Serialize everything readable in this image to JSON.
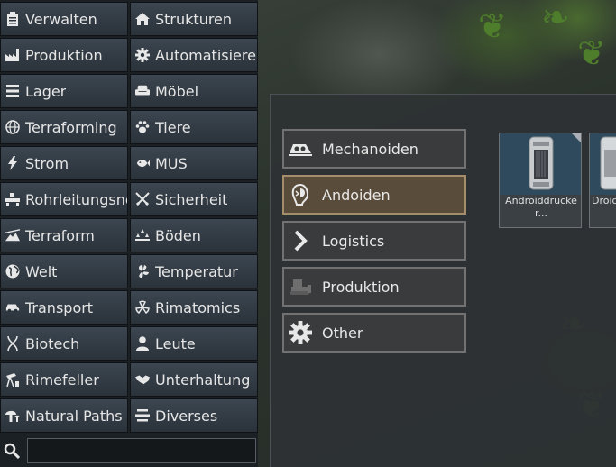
{
  "architect": {
    "categories": [
      {
        "label": "Verwalten",
        "icon": "clipboard-icon"
      },
      {
        "label": "Strukturen",
        "icon": "house-icon"
      },
      {
        "label": "Produktion",
        "icon": "factory-icon"
      },
      {
        "label": "Automatisieren",
        "icon": "gear-icon"
      },
      {
        "label": "Lager",
        "icon": "shelf-icon"
      },
      {
        "label": "Möbel",
        "icon": "armchair-icon"
      },
      {
        "label": "Terraforming",
        "icon": "globe-icon"
      },
      {
        "label": "Tiere",
        "icon": "paw-icon"
      },
      {
        "label": "Strom",
        "icon": "lightning-icon"
      },
      {
        "label": "MUS",
        "icon": "fish-icon"
      },
      {
        "label": "Rohrleitungsnetz",
        "icon": "pipe-icon"
      },
      {
        "label": "Sicherheit",
        "icon": "crossed-swords-icon"
      },
      {
        "label": "Terraform",
        "icon": "terrain-icon"
      },
      {
        "label": "Böden",
        "icon": "floor-icon"
      },
      {
        "label": "Welt",
        "icon": "earth-icon"
      },
      {
        "label": "Temperatur",
        "icon": "fan-icon"
      },
      {
        "label": "Transport",
        "icon": "car-icon"
      },
      {
        "label": "Rimatomics",
        "icon": "radiation-icon"
      },
      {
        "label": "Biotech",
        "icon": "dna-icon"
      },
      {
        "label": "Leute",
        "icon": "person-icon"
      },
      {
        "label": "Rimefeller",
        "icon": "oil-pump-icon"
      },
      {
        "label": "Unterhaltung",
        "icon": "handshake-icon"
      },
      {
        "label": "Natural Paths",
        "icon": "mushroom-icon"
      },
      {
        "label": "Diverses",
        "icon": "list-icon"
      }
    ],
    "search": {
      "value": "",
      "placeholder": ""
    }
  },
  "panel": {
    "subcategories": [
      {
        "label": "Mechanoiden",
        "icon": "mech-icon",
        "selected": false
      },
      {
        "label": "Andoiden",
        "icon": "android-head-icon",
        "selected": true
      },
      {
        "label": "Logistics",
        "icon": "chevron-right-icon",
        "selected": false
      },
      {
        "label": "Produktion",
        "icon": "bulldozer-icon",
        "selected": false
      },
      {
        "label": "Other",
        "icon": "gear-icon",
        "selected": false
      }
    ],
    "items": [
      {
        "label": "Androiddrucker...",
        "icon": "android-printer-icon"
      },
      {
        "label": "Droid",
        "icon": "droid-station-icon"
      }
    ]
  },
  "colors": {
    "selected_subcategory": "#5a4c3a",
    "selected_border": "#a38d6a",
    "category_button": "#343d46"
  }
}
